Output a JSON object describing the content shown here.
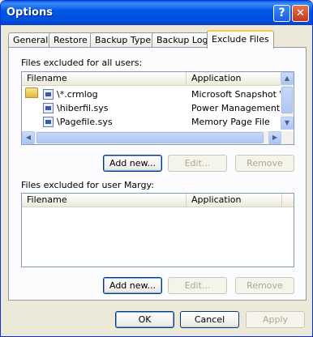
{
  "window": {
    "title": "Options"
  },
  "titlebar": {
    "help_glyph": "?",
    "close_glyph": "✕"
  },
  "tabs": [
    {
      "label": "General"
    },
    {
      "label": "Restore"
    },
    {
      "label": "Backup Type"
    },
    {
      "label": "Backup Log"
    },
    {
      "label": "Exclude Files",
      "active": true
    }
  ],
  "all_users": {
    "label": "Files excluded for all users:",
    "columns": [
      "Filename",
      "Application"
    ],
    "rows": [
      {
        "filename": "\\*.crmlog",
        "application": "Microsoft Snapshot Wr..."
      },
      {
        "filename": "\\hiberfil.sys",
        "application": "Power Management"
      },
      {
        "filename": "\\Pagefile.sys",
        "application": "Memory Page File"
      }
    ],
    "add_label": "Add new...",
    "edit_label": "Edit...",
    "remove_label": "Remove"
  },
  "user_margy": {
    "label": "Files excluded for user Margy:",
    "columns": [
      "Filename",
      "Application"
    ],
    "rows": [],
    "add_label": "Add new...",
    "edit_label": "Edit...",
    "remove_label": "Remove"
  },
  "footer": {
    "ok_label": "OK",
    "cancel_label": "Cancel",
    "apply_label": "Apply"
  },
  "icons": {
    "scroll_up": "▲",
    "scroll_down": "▼",
    "scroll_left": "◀",
    "scroll_right": "▶"
  }
}
